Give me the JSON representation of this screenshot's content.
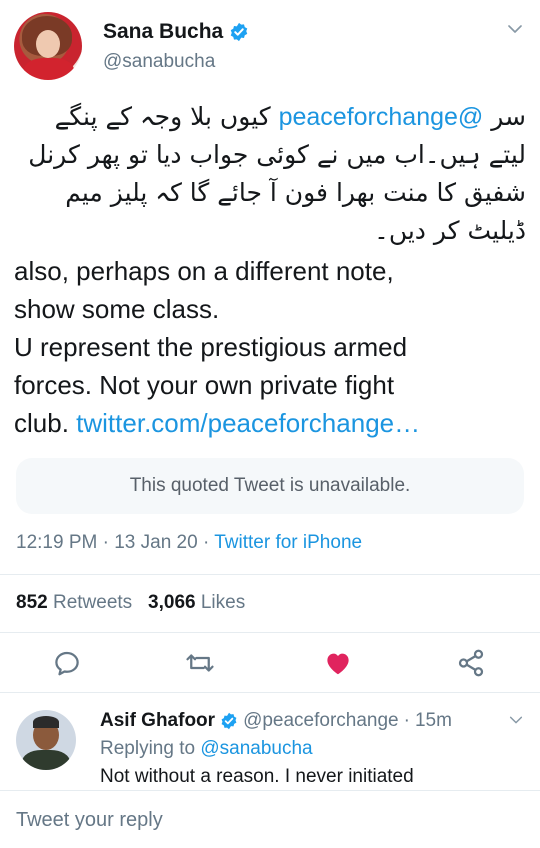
{
  "tweet": {
    "author_name": "Sana Bucha",
    "author_handle": "@sanabucha",
    "urdu_before": "سر ",
    "mention": "@peaceforchange",
    "urdu_after": " کیوں بلا وجہ کے پنگے لیتے ہیں۔اب میں نے کوئی جواب دیا تو پھر کرنل شفیق کا منت بھرا فون آ جائے گا کہ پلیز میم ڈیلیٹ کر دیں۔",
    "english_lines": [
      "also, perhaps on a different note,",
      "show some class.",
      "U represent the prestigious armed",
      "forces. Not your own private fight"
    ],
    "last_line_prefix": "club. ",
    "link_text": "twitter.com/peaceforchange…",
    "quoted_unavailable": "This quoted Tweet is unavailable.",
    "time": "12:19 PM",
    "date": "13 Jan 20",
    "source": "Twitter for iPhone",
    "retweets_count": "852",
    "retweets_label": "Retweets",
    "likes_count": "3,066",
    "likes_label": "Likes",
    "liked": true,
    "like_color": "#e0245e",
    "accent_color": "#1b95e0"
  },
  "actions": {
    "icons": [
      "reply-icon",
      "retweet-icon",
      "heart-icon",
      "share-icon"
    ]
  },
  "reply": {
    "author_name": "Asif Ghafoor",
    "author_handle": "@peaceforchange",
    "age": "15m",
    "replying_label": "Replying to",
    "replying_to": "@sanabucha",
    "text": "Not without a reason. I never initiated"
  },
  "composer": {
    "placeholder": "Tweet your reply"
  }
}
